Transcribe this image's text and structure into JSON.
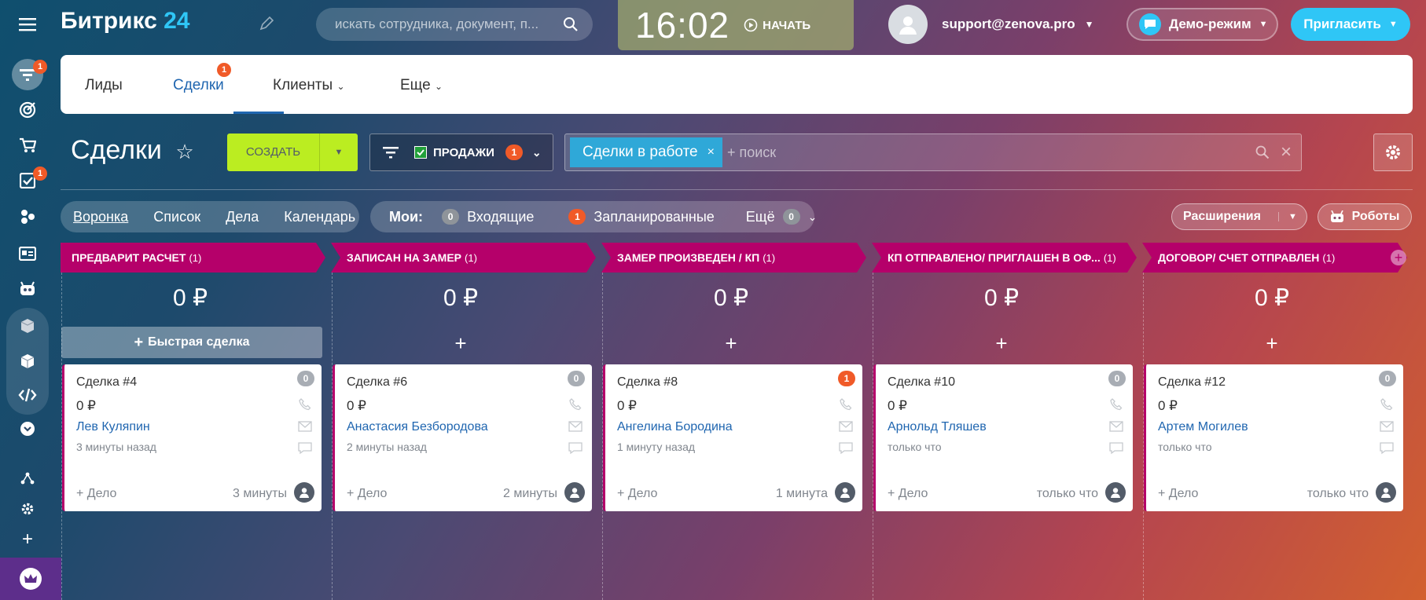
{
  "app": {
    "brand": "Битрикс",
    "brand_num": "24"
  },
  "search": {
    "placeholder": "искать сотрудника, документ, п..."
  },
  "clock": {
    "time": "16:02",
    "start_label": "НАЧАТЬ"
  },
  "user": {
    "email": "support@zenova.pro"
  },
  "demo": {
    "label": "Демо-режим"
  },
  "invite": {
    "label": "Пригласить"
  },
  "rail": {
    "badges": {
      "funnel": "1",
      "tasks": "1"
    }
  },
  "tabs": [
    {
      "label": "Лиды"
    },
    {
      "label": "Сделки",
      "badge": "1"
    },
    {
      "label": "Клиенты"
    },
    {
      "label": "Еще"
    }
  ],
  "page": {
    "title": "Сделки"
  },
  "toolbar": {
    "create_label": "СОЗДАТЬ",
    "filter_label": "ПРОДАЖИ",
    "filter_badge": "1",
    "chip_label": "Сделки в работе",
    "search_placeholder": "+ поиск"
  },
  "views": [
    "Воронка",
    "Список",
    "Дела",
    "Календарь"
  ],
  "counters": {
    "my_label": "Мои:",
    "incoming_count": "0",
    "incoming_label": "Входящие",
    "planned_count": "1",
    "planned_label": "Запланированные",
    "more_label": "Ещё",
    "more_count": "0"
  },
  "extensions": {
    "label": "Расширения"
  },
  "robots": {
    "label": "Роботы"
  },
  "quick_deal": {
    "label": "Быстрая сделка"
  },
  "columns": [
    {
      "title": "ПРЕДВАРИТ РАСЧЕТ",
      "count": "(1)",
      "sum": "0 ₽"
    },
    {
      "title": "ЗАПИСАН НА ЗАМЕР",
      "count": "(1)",
      "sum": "0 ₽"
    },
    {
      "title": "ЗАМЕР ПРОИЗВЕДЕН / КП",
      "count": "(1)",
      "sum": "0 ₽"
    },
    {
      "title": "КП ОТПРАВЛЕНО/ ПРИГЛАШЕН В ОФ...",
      "count": "(1)",
      "sum": "0 ₽"
    },
    {
      "title": "ДОГОВОР/ СЧЕТ ОТПРАВЛЕН",
      "count": "(1)",
      "sum": "0 ₽"
    }
  ],
  "cards": [
    {
      "name": "Сделка #4",
      "sum": "0 ₽",
      "contact": "Лев Куляпин",
      "when": "3 минуты назад",
      "badge": "0",
      "deal": "+ Дело",
      "ago": "3 минуты"
    },
    {
      "name": "Сделка #6",
      "sum": "0 ₽",
      "contact": "Анастасия Безбородова",
      "when": "2 минуты назад",
      "badge": "0",
      "deal": "+ Дело",
      "ago": "2 минуты"
    },
    {
      "name": "Сделка #8",
      "sum": "0 ₽",
      "contact": "Ангелина Бородина",
      "when": "1 минуту назад",
      "badge": "1",
      "deal": "+ Дело",
      "ago": "1 минута"
    },
    {
      "name": "Сделка #10",
      "sum": "0 ₽",
      "contact": "Арнольд Тляшев",
      "when": "только что",
      "badge": "0",
      "deal": "+ Дело",
      "ago": "только что"
    },
    {
      "name": "Сделка #12",
      "sum": "0 ₽",
      "contact": "Артем Могилев",
      "when": "только что",
      "badge": "0",
      "deal": "+ Дело",
      "ago": "только что"
    }
  ],
  "colors": {
    "accent": "#2fc6f6",
    "stage": "#b5006a",
    "create": "#bbed21",
    "badge": "#f05a28",
    "link": "#2066b0"
  }
}
